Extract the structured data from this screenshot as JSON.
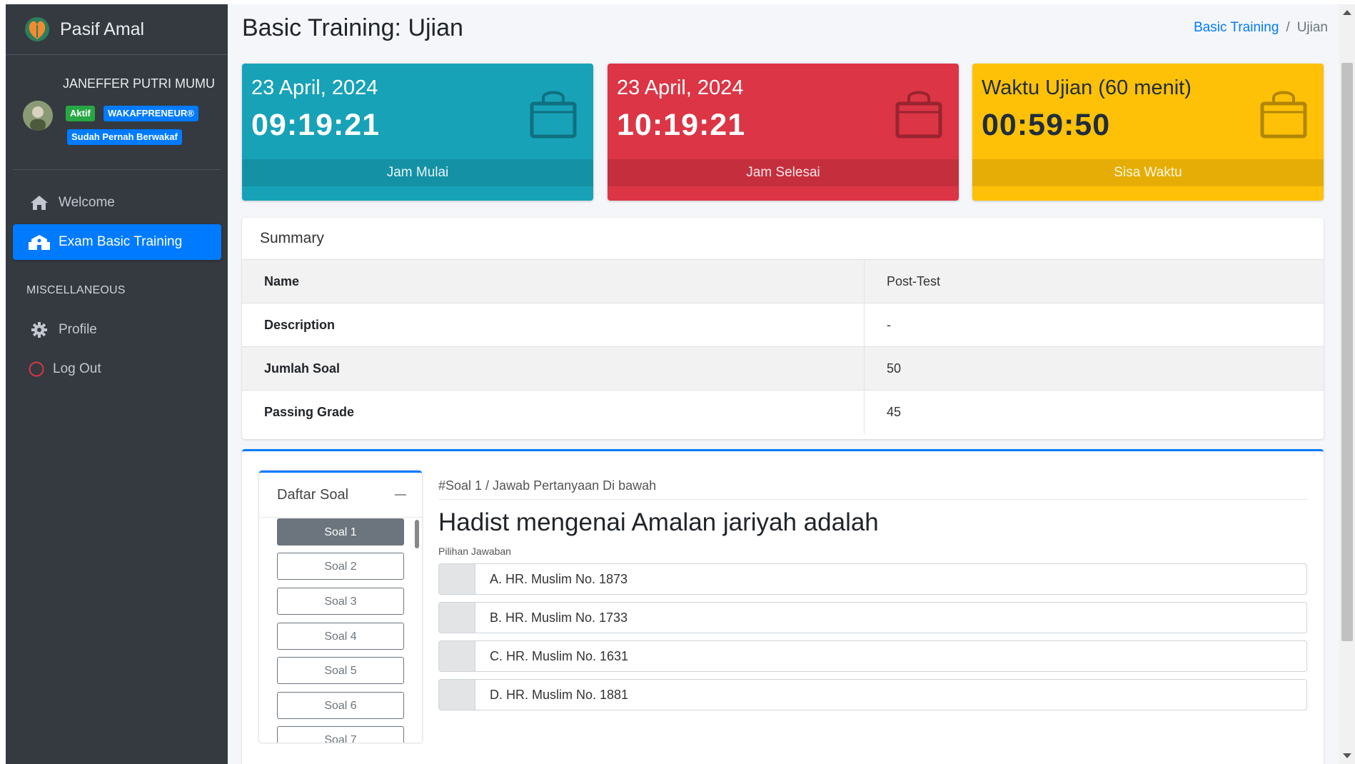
{
  "app": {
    "brand": "Pasif Amal",
    "user_name": "JANEFFER PUTRI MUMU",
    "badges": [
      "Aktif",
      "WAKAFPRENEUR®",
      "Sudah Pernah Berwakaf"
    ]
  },
  "sidebar": {
    "items": [
      {
        "label": "Welcome",
        "icon": "home-icon"
      },
      {
        "label": "Exam Basic Training",
        "icon": "school-icon",
        "active": true
      }
    ],
    "header": "MISCELLANEOUS",
    "misc_items": [
      {
        "label": "Profile",
        "icon": "gear-icon"
      },
      {
        "label": "Log Out",
        "icon": "power-circle-icon"
      }
    ]
  },
  "page": {
    "title": "Basic Training: Ujian",
    "breadcrumb": [
      "Basic Training",
      "Ujian"
    ]
  },
  "boxes": [
    {
      "heading": "23 April, 2024",
      "value": "09:19:21",
      "footer": "Jam Mulai",
      "color": "#17a2b8",
      "icon": "shopping-bag-icon"
    },
    {
      "heading": "23 April, 2024",
      "value": "10:19:21",
      "footer": "Jam Selesai",
      "color": "#dc3545",
      "icon": "shopping-bag-icon"
    },
    {
      "heading": "Waktu Ujian (60 menit)",
      "value": "00:59:50",
      "footer": "Sisa Waktu",
      "color": "#ffc107",
      "icon": "shopping-bag-icon"
    }
  ],
  "summary": {
    "title": "Summary",
    "rows": [
      {
        "key": "Name",
        "value": "Post-Test"
      },
      {
        "key": "Description",
        "value": "-"
      },
      {
        "key": "Jumlah Soal",
        "value": "50"
      },
      {
        "key": "Passing Grade",
        "value": "45"
      }
    ]
  },
  "exam": {
    "list_title": "Daftar Soal",
    "questions": [
      "Soal 1",
      "Soal 2",
      "Soal 3",
      "Soal 4",
      "Soal 5",
      "Soal 6",
      "Soal 7"
    ],
    "current": "Soal 1",
    "caption": "#Soal 1 / Jawab Pertanyaan Di bawah",
    "question_text": "Hadist mengenai Amalan jariyah adalah",
    "answers_label": "Pilihan Jawaban",
    "options": [
      "A. HR. Muslim No. 1873",
      "B. HR. Muslim No. 1733",
      "C. HR. Muslim No. 1631",
      "D. HR. Muslim No. 1881"
    ]
  },
  "colors": {
    "sidebar": "#343a40",
    "primary": "#007bff",
    "info": "#17a2b8",
    "danger": "#dc3545",
    "warning": "#ffc107"
  }
}
